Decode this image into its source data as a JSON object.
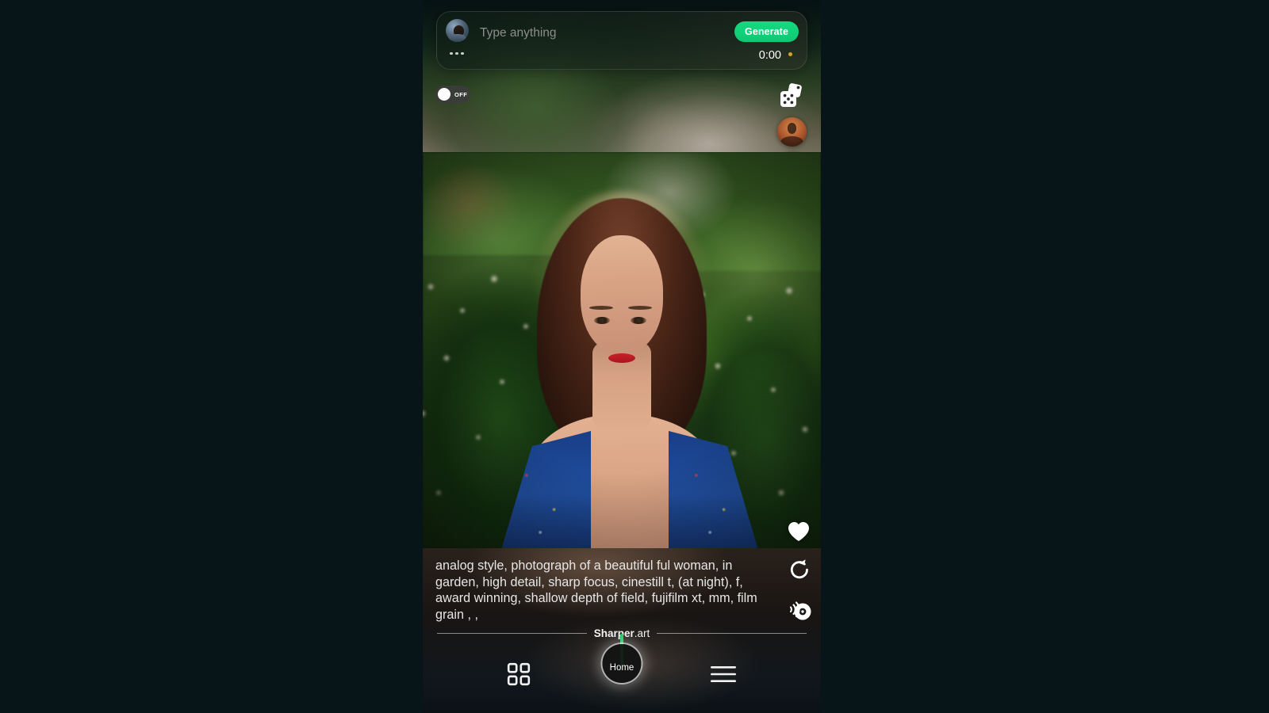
{
  "app": {
    "brand_bold": "Sharper",
    "brand_light": ".art",
    "background_color": "#071418",
    "accent_green": "#17d97f",
    "home_bar_green": "#22c55e",
    "timer_dot_color": "#d6a32a"
  },
  "prompt_bar": {
    "avatar_name": "user-avatar",
    "input_value": "",
    "input_placeholder": "Type anything",
    "generate_label": "Generate",
    "overflow_label": "...",
    "timer": "0:00"
  },
  "controls": {
    "toggle_state": "OFF",
    "dice_label": "randomize",
    "thumbnails": [
      "thumbnail-1",
      "thumbnail-2"
    ]
  },
  "result": {
    "like_label": "favorite",
    "prompt_text": "analog style, photograph of a beautiful ful woman, in garden, high detail, sharp focus, cinestill t, (at night), f, award winning, shallow depth of field, fujifilm xt, mm, film grain , ,",
    "actions": [
      {
        "name": "regenerate-icon",
        "label": "regenerate"
      },
      {
        "name": "radar-icon",
        "label": "upscale"
      }
    ]
  },
  "navbar": {
    "grid_label": "gallery",
    "home_label": "Home",
    "menu_label": "menu"
  }
}
